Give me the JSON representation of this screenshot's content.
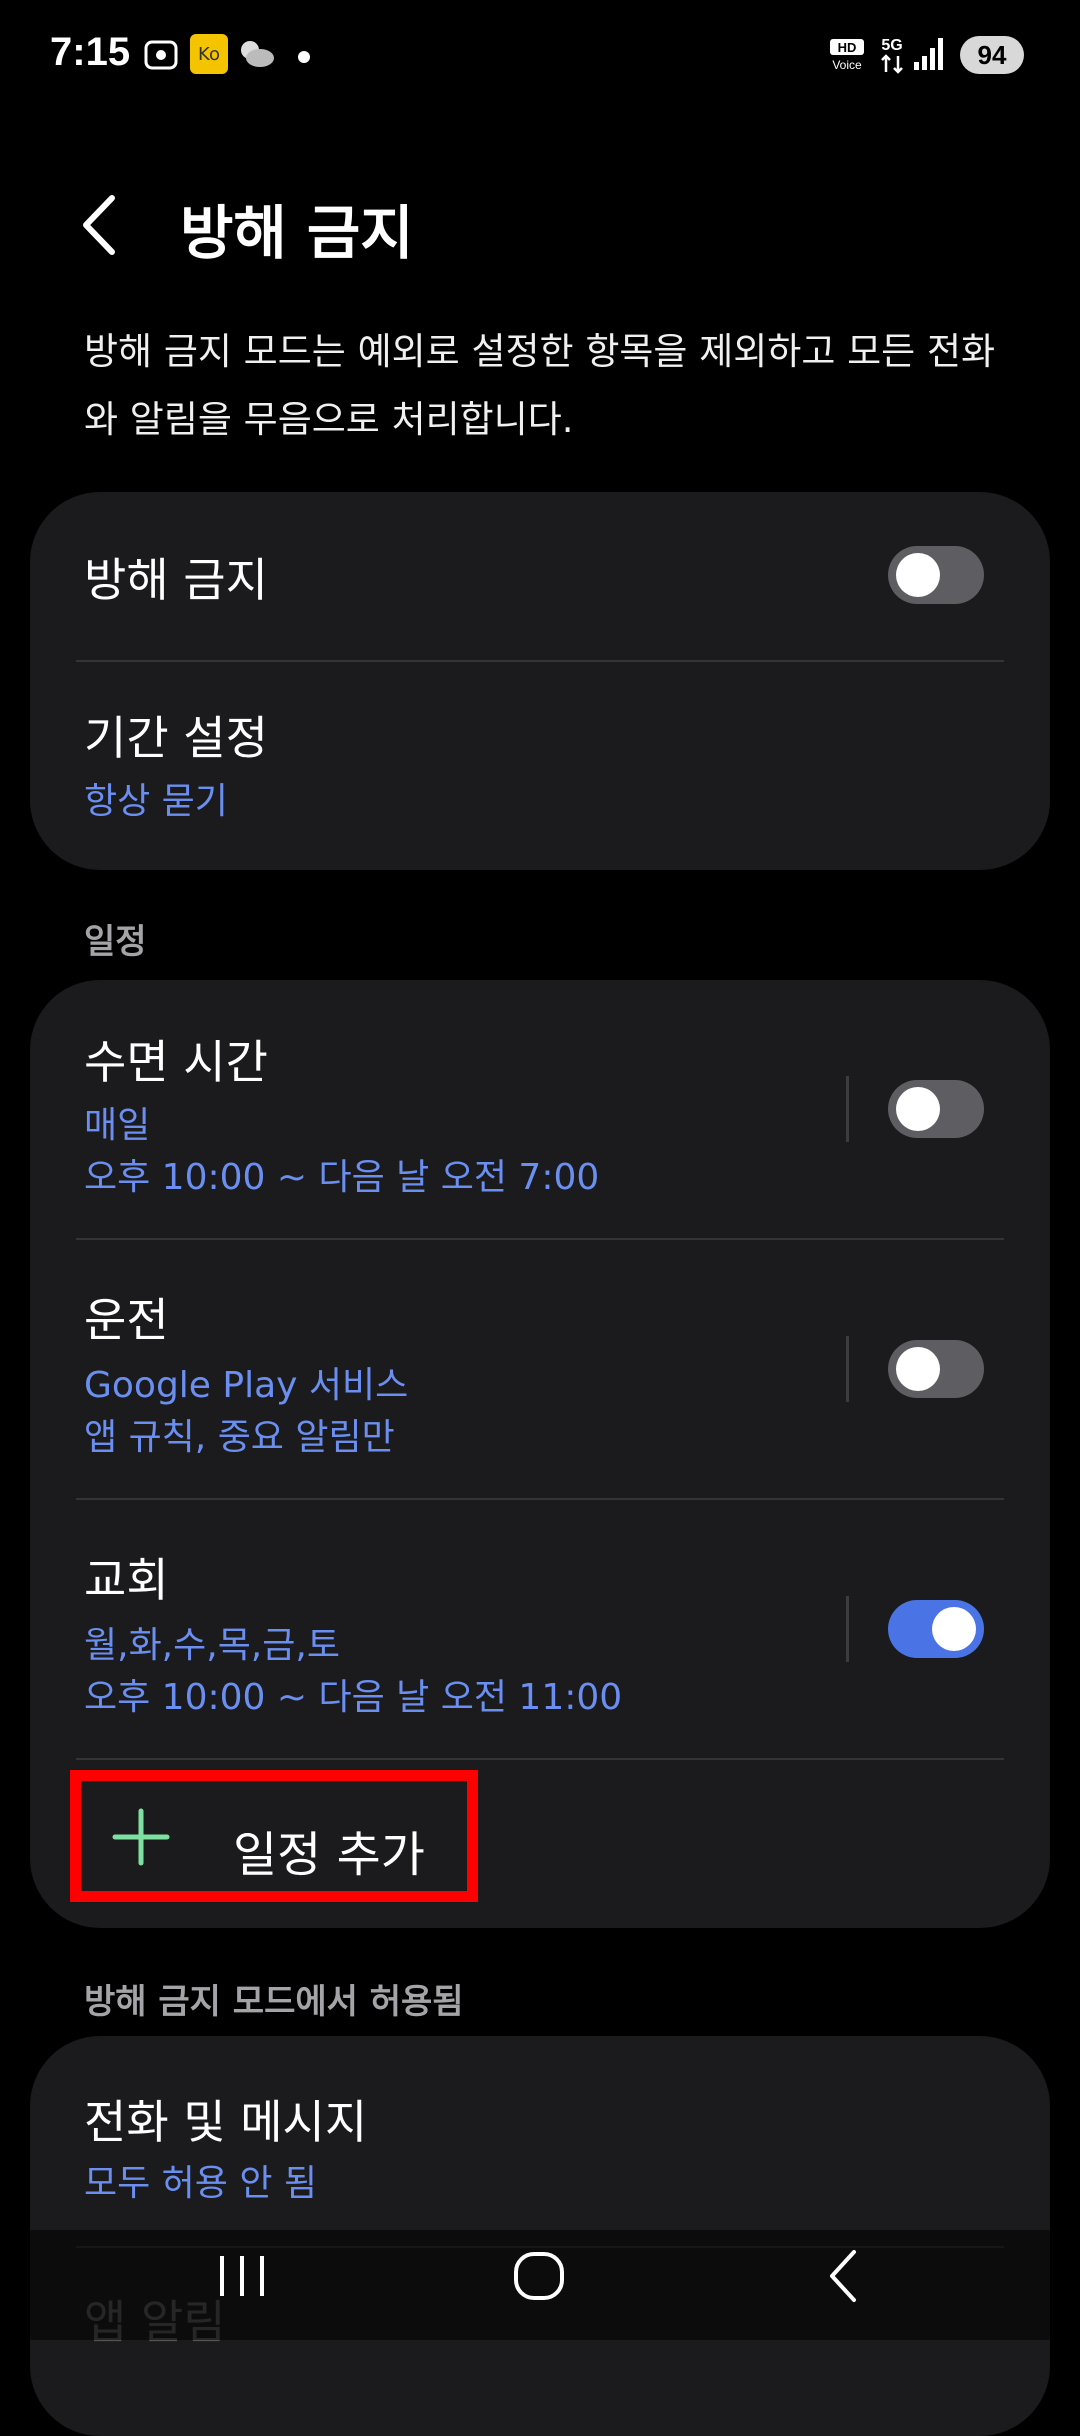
{
  "status_bar": {
    "time": "7:15",
    "battery": "94",
    "icons": [
      "screenshot-icon",
      "app-badge-icon",
      "weather-icon",
      "notification-dot-icon",
      "hd-voice-icon",
      "5g-icon",
      "signal-icon",
      "battery-icon"
    ],
    "hd_label": "HD",
    "voice_label": "Voice",
    "network_label": "5G"
  },
  "header": {
    "title": "방해 금지"
  },
  "description": "방해 금지 모드는 예외로 설정한 항목을 제외하고 모든 전화와 알림을 무음으로 처리합니다.",
  "main_card": {
    "dnd_label": "방해 금지",
    "dnd_on": false,
    "duration_title": "기간 설정",
    "duration_value": "항상 묻기"
  },
  "schedule_section": {
    "label": "일정",
    "items": [
      {
        "title": "수면 시간",
        "line1": "매일",
        "line2": "오후 10:00 ~ 다음 날 오전 7:00",
        "on": false
      },
      {
        "title": "운전",
        "line1": "Google Play 서비스",
        "line2": "앱 규칙, 중요 알림만",
        "on": false
      },
      {
        "title": "교회",
        "line1": "월,화,수,목,금,토",
        "line2": "오후 10:00 ~ 다음 날 오전 11:00",
        "on": true
      }
    ],
    "add_label": "일정 추가"
  },
  "allowed_section": {
    "label": "방해 금지 모드에서 허용됨",
    "calls_title": "전화 및 메시지",
    "calls_value": "모두 허용 안 됨",
    "next_title_partial": "앱 알림"
  },
  "colors": {
    "accent_blue": "#6b8ff0",
    "toggle_on": "#4a74e6",
    "add_icon_green": "#7ee0a0",
    "highlight_red": "#ff0000"
  }
}
